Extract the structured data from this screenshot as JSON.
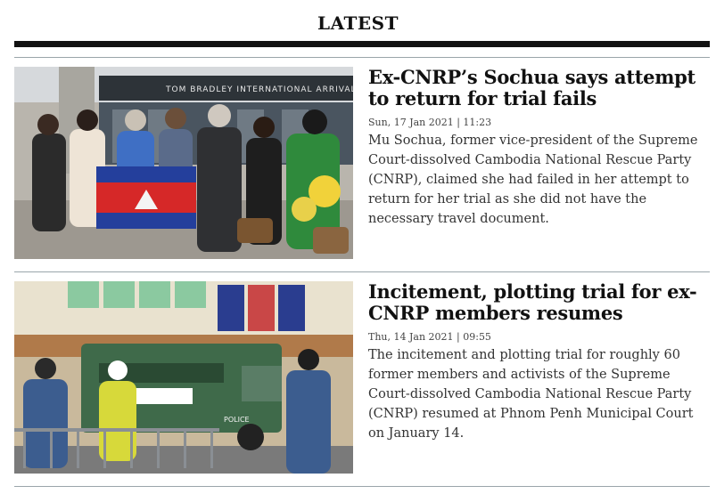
{
  "section": {
    "title": "LATEST"
  },
  "articles": [
    {
      "headline": "Ex-CNRP’s Sochua says attempt to return for trial fails",
      "date": "Sun, 17 Jan 2021 | 11:23",
      "summary": "Mu Sochua, former vice-president of the Supreme Court-dissolved Cambodia National Rescue Party (CNRP), claimed she had failed in her attempt to return for her trial as she did not have the necessary travel document.",
      "image_sign": "TOM BRADLEY INTERNATIONAL ARRIVALS"
    },
    {
      "headline": "Incitement, plotting trial for ex-CNRP members resumes",
      "date": "Thu, 14 Jan 2021 | 09:55",
      "summary": "The incitement and plotting trial for roughly 60 former members and activists of the Supreme Court-dissolved Cambodia National Rescue Party (CNRP) resumed at Phnom Penh Municipal Court on January 14.",
      "image_plate": "POLICE"
    }
  ]
}
